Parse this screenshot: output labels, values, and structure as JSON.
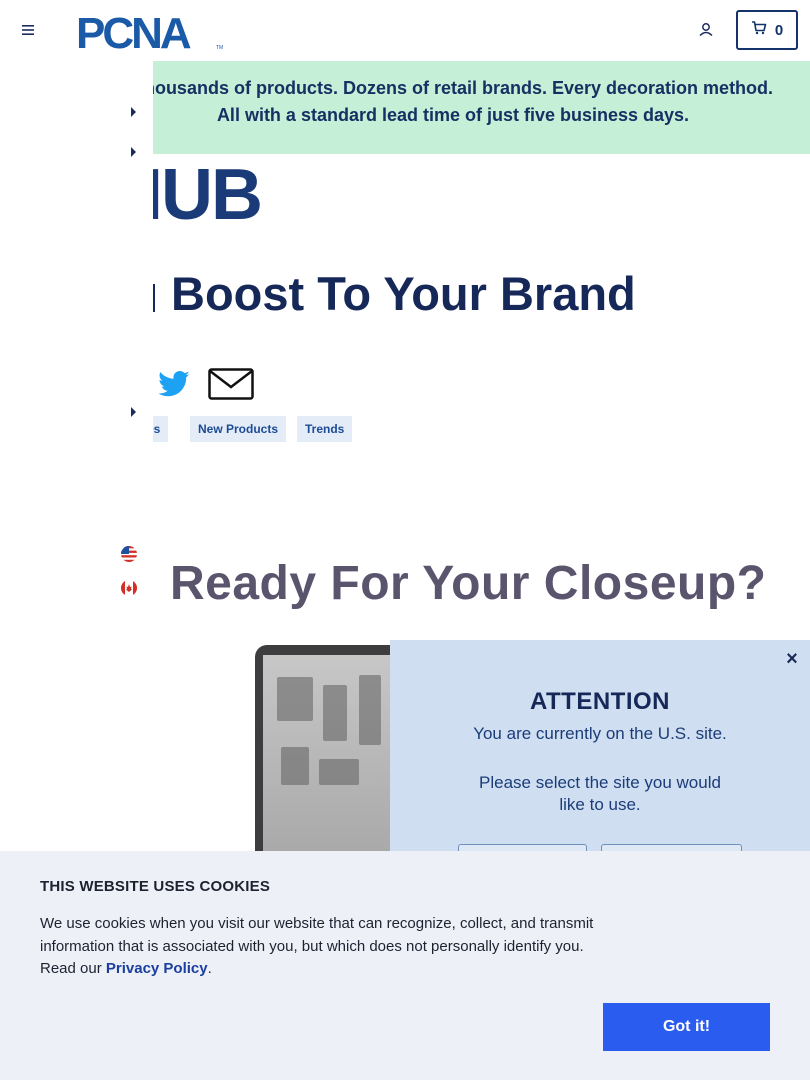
{
  "header": {
    "menu_icon": "hamburger-icon",
    "logo_text": "PCNA",
    "account_icon": "user-icon",
    "cart_icon": "cart-icon",
    "cart_count": "0"
  },
  "banner": {
    "text": "Thousands of products. Dozens of retail brands. Every decoration method. All with a standard lead time of just five business days."
  },
  "hub": {
    "wordmark": "HUB"
  },
  "article": {
    "headline": "Boost To Your Brand",
    "share_icons": [
      "twitter-icon",
      "mail-icon"
    ],
    "tags": [
      "ries",
      "New Products",
      "Trends"
    ]
  },
  "flags": [
    "us-flag-icon",
    "canada-flag-icon"
  ],
  "hero": {
    "title": "Ready For Your Closeup?"
  },
  "site_modal": {
    "close_icon": "close-icon",
    "close_label": "×",
    "title": "ATTENTION",
    "line1": "You are currently on the U.S. site.",
    "line2": "Please select the site you would like to use."
  },
  "cookie_banner": {
    "title": "THIS WEBSITE USES COOKIES",
    "body": "We use cookies when you visit our website that can recognize, collect, and transmit information that is associated with you, but which does not personally identify you. Read our ",
    "link": "Privacy Policy",
    "after_link": ".",
    "button": "Got it!"
  },
  "colors": {
    "navy": "#152858",
    "banner_bg": "#c5efd6",
    "modal_bg": "#cfdff1",
    "cookie_bg": "#eef0f8",
    "button_blue": "#2a5cf0"
  }
}
